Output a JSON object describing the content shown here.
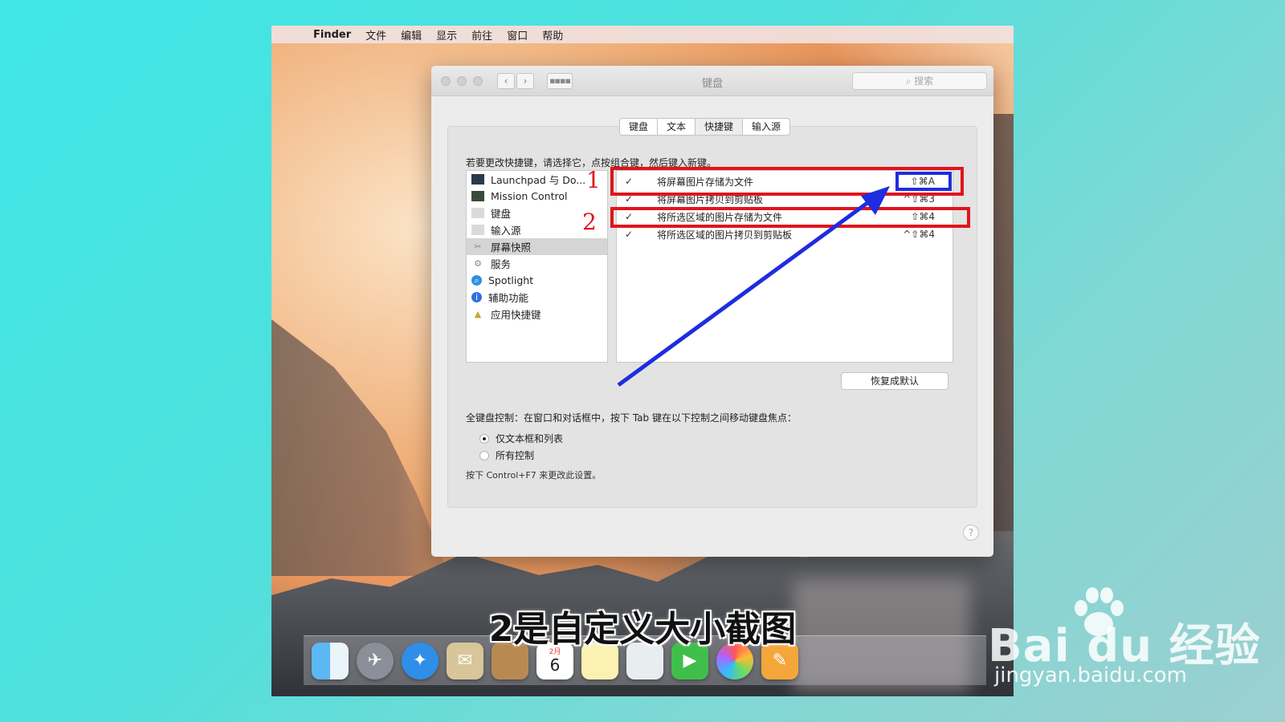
{
  "menubar": {
    "items": [
      "Finder",
      "文件",
      "编辑",
      "显示",
      "前往",
      "窗口",
      "帮助"
    ]
  },
  "window": {
    "title": "键盘",
    "search_placeholder": "搜索",
    "tabs": [
      "键盘",
      "文本",
      "快捷键",
      "输入源"
    ],
    "active_tab": "快捷键",
    "instruction": "若要更改快捷键，请选择它，点按组合键，然后键入新键。",
    "categories": [
      {
        "label": "Launchpad 与 Do...",
        "icon": "launchpad-icon"
      },
      {
        "label": "Mission Control",
        "icon": "mission-control-icon"
      },
      {
        "label": "键盘",
        "icon": "keyboard-icon"
      },
      {
        "label": "输入源",
        "icon": "input-source-icon"
      },
      {
        "label": "屏幕快照",
        "icon": "screenshot-icon"
      },
      {
        "label": "服务",
        "icon": "gear-icon"
      },
      {
        "label": "Spotlight",
        "icon": "spotlight-icon"
      },
      {
        "label": "辅助功能",
        "icon": "accessibility-icon"
      },
      {
        "label": "应用快捷键",
        "icon": "app-shortcut-icon"
      }
    ],
    "selected_category": "屏幕快照",
    "shortcuts": [
      {
        "checked": "✓",
        "label": "将屏幕图片存储为文件",
        "key": "⇧⌘A"
      },
      {
        "checked": "✓",
        "label": "将屏幕图片拷贝到剪贴板",
        "key": "^⇧⌘3"
      },
      {
        "checked": "✓",
        "label": "将所选区域的图片存储为文件",
        "key": "⇧⌘4"
      },
      {
        "checked": "✓",
        "label": "将所选区域的图片拷贝到剪贴板",
        "key": "^⇧⌘4"
      }
    ],
    "restore_label": "恢复成默认",
    "full_keyboard_desc": "全键盘控制：在窗口和对话框中，按下 Tab 键在以下控制之间移动键盘焦点：",
    "radio_options": [
      "仅文本框和列表",
      "所有控制"
    ],
    "radio_selected": "仅文本框和列表",
    "hint": "按下 Control+F7 来更改此设置。",
    "help_label": "?"
  },
  "annotations": {
    "num1": "1",
    "num2": "2",
    "red": "#e0141b",
    "blue": "#1d2de0"
  },
  "dock": {
    "icons": [
      "finder-icon",
      "launchpad-rocket-icon",
      "safari-icon",
      "mail-icon",
      "contacts-icon",
      "calendar-icon",
      "notes-icon",
      "reminders-icon",
      "facetime-icon",
      "photos-icon",
      "pages-icon"
    ],
    "calendar_day": "6",
    "calendar_month": "2月"
  },
  "subtitle": "2是自定义大小截图",
  "watermark": {
    "logo": "Bai du 经验",
    "url": "jingyan.baidu.com"
  }
}
